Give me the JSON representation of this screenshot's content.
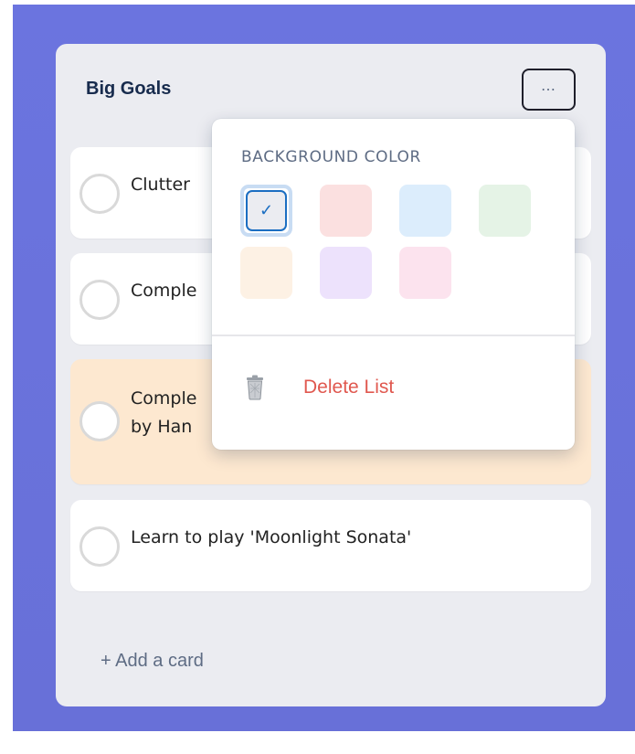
{
  "list": {
    "title": "Big Goals",
    "menu_icon": "ellipsis-icon",
    "menu_label": "⋯",
    "cards": [
      {
        "text": "Clutter",
        "color": "#ffffff"
      },
      {
        "text": "Comple",
        "color": "#ffffff"
      },
      {
        "text": "Comple\nby Han",
        "color": "#fde8d0"
      },
      {
        "text": "Learn to play 'Moonlight Sonata'",
        "color": "#ffffff"
      }
    ],
    "add_card_label": "+ Add a card"
  },
  "menu": {
    "heading": "BACKGROUND COLOR",
    "swatches": [
      {
        "color": "#ebecf1",
        "selected": true,
        "check": "✓"
      },
      {
        "color": "#fbe0e0",
        "selected": false
      },
      {
        "color": "#dcedfc",
        "selected": false
      },
      {
        "color": "#e5f3e6",
        "selected": false
      },
      {
        "color": "#fdf1e4",
        "selected": false
      },
      {
        "color": "#ede2fc",
        "selected": false
      },
      {
        "color": "#fce3ee",
        "selected": false
      }
    ],
    "delete_label": "Delete List",
    "delete_icon": "trash-icon",
    "delete_color": "#e0584f"
  },
  "colors": {
    "board_background": "#6b74df",
    "list_background": "#ebecf1",
    "accent": "#1b6ec2"
  }
}
